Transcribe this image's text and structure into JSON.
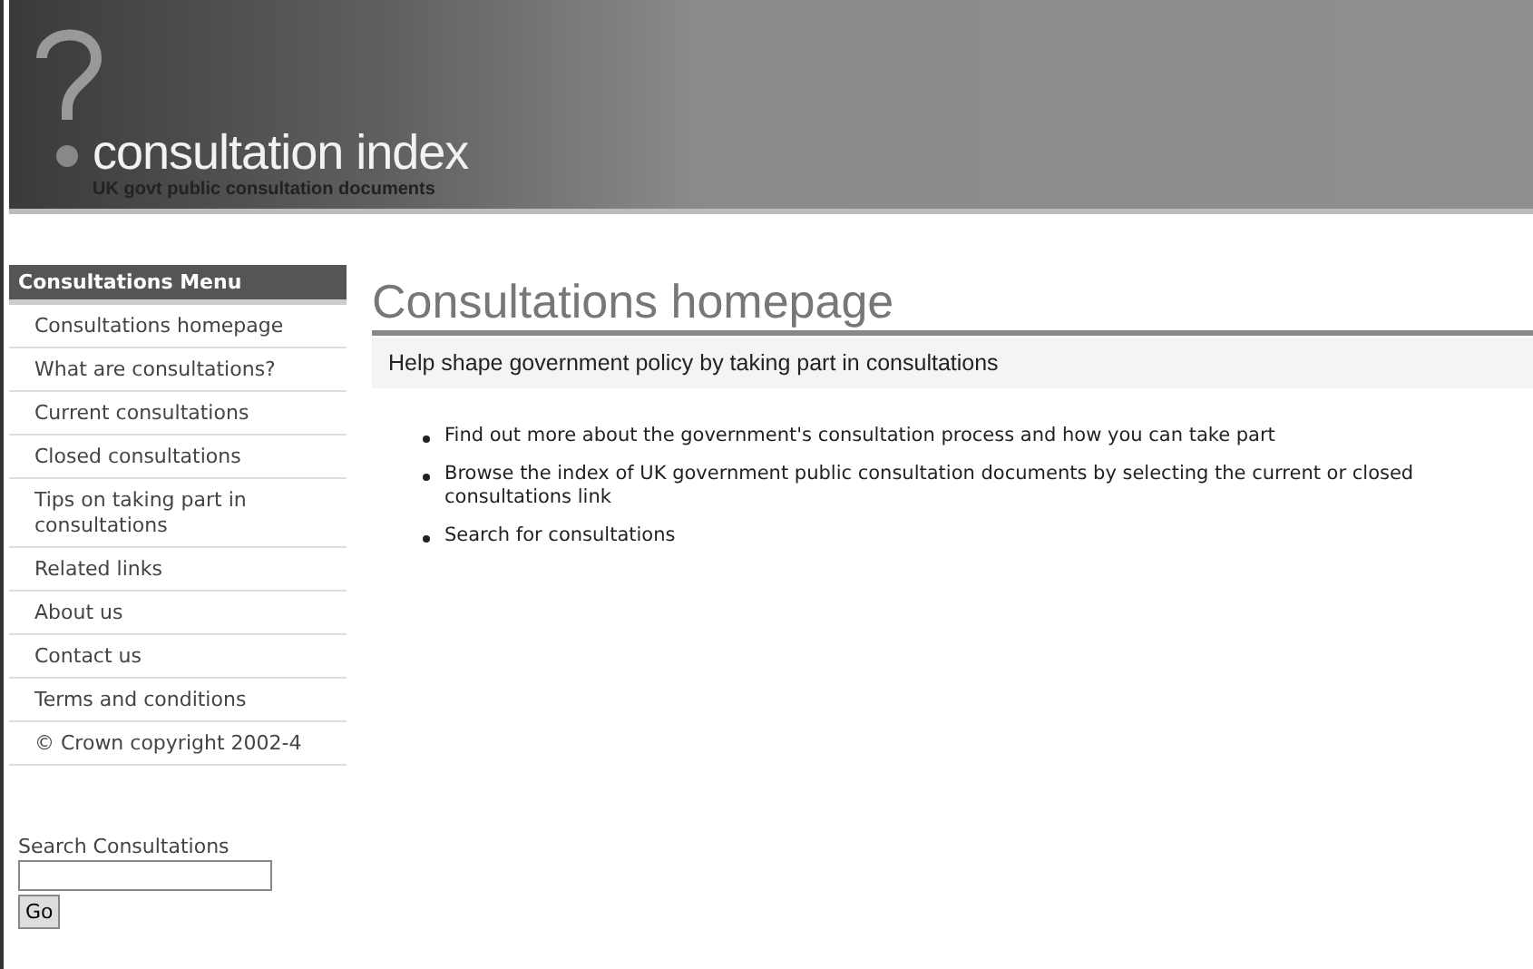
{
  "header": {
    "logo_title": "consultation index",
    "logo_subtitle": "UK govt public consultation documents"
  },
  "sidebar": {
    "heading": "Consultations Menu",
    "items": [
      "Consultations homepage",
      "What are consultations?",
      "Current consultations",
      "Closed consultations",
      "Tips on taking part in consultations",
      "Related links",
      "About us",
      "Contact us",
      "Terms and conditions"
    ],
    "copyright": "© Crown copyright 2002-4",
    "search": {
      "label": "Search Consultations",
      "button": "Go"
    }
  },
  "main": {
    "title": "Consultations homepage",
    "intro": "Help shape government policy by taking part in consultations",
    "bullets": [
      "Find out more about the government's consultation process and how you can take part",
      "Browse the index of UK government public consultation documents by selecting the current or closed consultations link",
      "Search for consultations"
    ]
  }
}
